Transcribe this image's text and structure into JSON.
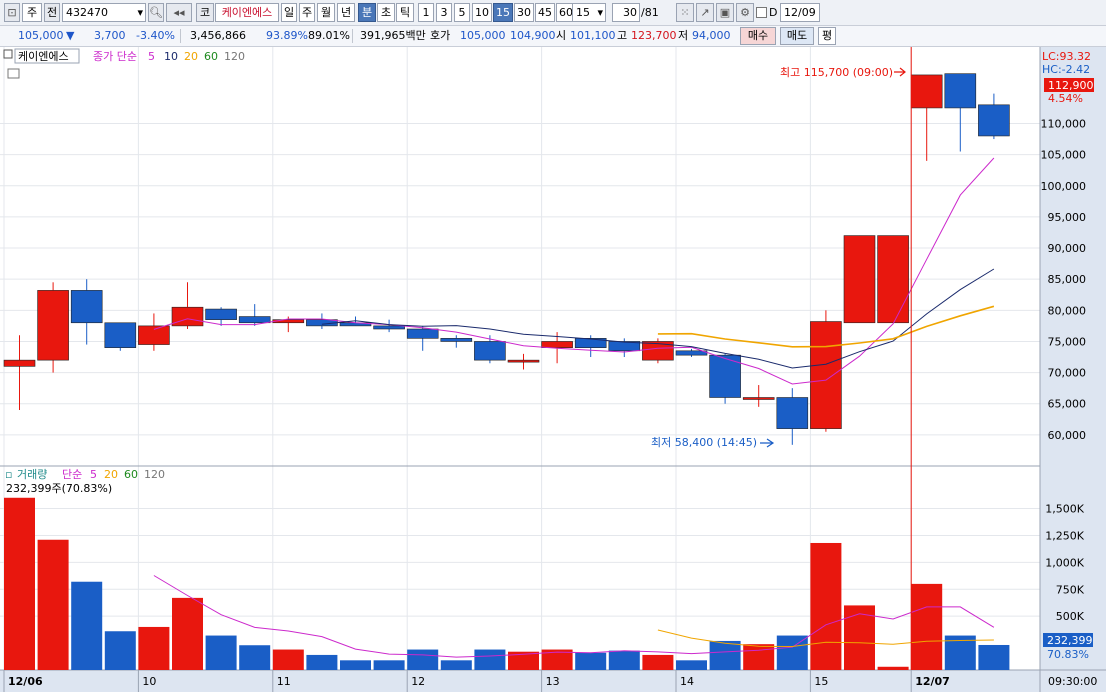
{
  "toolbar": {
    "market": "주",
    "prev": "전",
    "code": "432470",
    "kr_mark": "코",
    "stock_name": "케이엔에스",
    "periods": [
      "일",
      "주",
      "월",
      "년",
      "분",
      "초",
      "틱"
    ],
    "intervals": [
      "1",
      "3",
      "5",
      "10",
      "15",
      "30",
      "45",
      "60"
    ],
    "interval_value": "15",
    "count": "30",
    "count_total": "/81",
    "d_label": "D",
    "date": "12/09"
  },
  "quote": {
    "price": "105,000",
    "down_arrow": "▼",
    "change": "3,700",
    "change_pct": "-3.40%",
    "volume": "3,456,866",
    "ratio1": "93.89%",
    "ratio2": "89.01%",
    "amount": "391,965백만",
    "hoga_label": "호가",
    "ask": "105,000",
    "bid": "104,900",
    "open_label": "시",
    "open": "101,100",
    "high_label": "고",
    "high": "123,700",
    "low_label": "저",
    "low": "94,000",
    "buy": "매수",
    "sell": "매도",
    "eval": "평"
  },
  "price_panel": {
    "legend_name": "케이엔에스",
    "legend_label": "종가 단순",
    "ma_periods": [
      "5",
      "10",
      "20",
      "60",
      "120"
    ],
    "ma_colors": [
      "#cc29cc",
      "#1a2a6c",
      "#f0a500",
      "#1e8a1e",
      "#777777"
    ],
    "lc": "LC:93.32",
    "hc": "HC:-2.42",
    "current_price": "112,900",
    "current_pct": "4.54%",
    "max_label": "최고 115,700 (09:00)",
    "min_label": "최저 58,400 (14:45)"
  },
  "volume_panel": {
    "legend_label": "거래량",
    "legend_type": "단순",
    "ma_periods": [
      "5",
      "20",
      "60",
      "120"
    ],
    "ma_colors": [
      "#cc29cc",
      "#f0a500",
      "#1e8a1e",
      "#777777"
    ],
    "info": "232,399주(70.83%)",
    "current": "232,399",
    "current_pct": "70.83%"
  },
  "time_axis": {
    "labels": [
      {
        "text": "12/06",
        "bold": true,
        "bar": 0
      },
      {
        "text": "10",
        "bold": false,
        "bar": 4
      },
      {
        "text": "11",
        "bold": false,
        "bar": 8
      },
      {
        "text": "12",
        "bold": false,
        "bar": 12
      },
      {
        "text": "13",
        "bold": false,
        "bar": 16
      },
      {
        "text": "14",
        "bold": false,
        "bar": 20
      },
      {
        "text": "15",
        "bold": false,
        "bar": 24
      },
      {
        "text": "12/07",
        "bold": true,
        "bar": 27
      }
    ],
    "clock": "09:30:00"
  },
  "colors": {
    "up": "#e8170e",
    "down": "#1a5ec6",
    "ma5": "#cc29cc",
    "ma10": "#1a2a6c",
    "ma20": "#f0a500",
    "axis_bg": "#dde5f1"
  },
  "chart_data": {
    "type": "candlestick",
    "x": [
      "09:00",
      "09:15",
      "09:30",
      "09:45",
      "10:00",
      "10:15",
      "10:30",
      "10:45",
      "11:00",
      "11:15",
      "11:30",
      "11:45",
      "12:00",
      "12:15",
      "12:30",
      "12:45",
      "13:00",
      "13:15",
      "13:30",
      "13:45",
      "14:00",
      "14:15",
      "14:30",
      "14:45",
      "15:00",
      "15:15",
      "15:30",
      "09:00",
      "09:15",
      "09:30"
    ],
    "open": [
      71000,
      72000,
      83200,
      78000,
      74500,
      77500,
      80200,
      79000,
      78000,
      78500,
      78000,
      77500,
      77000,
      75500,
      75000,
      71800,
      74000,
      75500,
      75000,
      72000,
      73500,
      72800,
      66000,
      66000,
      61000,
      78000,
      78000,
      112500,
      118000,
      113000
    ],
    "high": [
      76000,
      84500,
      85000,
      78000,
      79500,
      84500,
      80500,
      81000,
      79000,
      79500,
      79000,
      78500,
      77500,
      76000,
      76000,
      73000,
      76500,
      76000,
      75500,
      75500,
      73800,
      73000,
      68000,
      67500,
      80000,
      92000,
      92000,
      115700,
      115300,
      114800
    ],
    "low": [
      64000,
      70000,
      74500,
      73500,
      73500,
      77000,
      77500,
      77500,
      76500,
      77000,
      77500,
      76500,
      73500,
      74000,
      71500,
      70500,
      71500,
      72500,
      72500,
      71500,
      72500,
      65000,
      64500,
      58400,
      60500,
      78000,
      78000,
      104000,
      105500,
      107500
    ],
    "close": [
      72000,
      83200,
      78000,
      74000,
      77500,
      80500,
      78500,
      78000,
      78500,
      77500,
      77500,
      77000,
      75500,
      75000,
      72000,
      72000,
      75000,
      74000,
      73500,
      75000,
      72800,
      66000,
      66000,
      61000,
      78200,
      92000,
      92000,
      117800,
      112500,
      108000
    ],
    "ma5_price": [
      null,
      null,
      null,
      null,
      null,
      null,
      null,
      null,
      null,
      null,
      null,
      null,
      null,
      null,
      null,
      null,
      null,
      null,
      null,
      null,
      null,
      null,
      null,
      null,
      null,
      null,
      null,
      null,
      null,
      null
    ],
    "ymin": 55000,
    "ymax": 121000,
    "yticks": [
      60000,
      65000,
      70000,
      75000,
      80000,
      85000,
      90000,
      95000,
      100000,
      105000,
      110000
    ],
    "volume": [
      1600000,
      1210000,
      820000,
      360000,
      400000,
      670000,
      320000,
      230000,
      190000,
      140000,
      90000,
      90000,
      190000,
      90000,
      190000,
      170000,
      190000,
      160000,
      180000,
      140000,
      90000,
      270000,
      240000,
      320000,
      1180000,
      600000,
      30000,
      800000,
      320000,
      232399
    ],
    "vmax": 1700000,
    "vticks": [
      500000,
      750000,
      1000000,
      1250000,
      1500000
    ]
  }
}
